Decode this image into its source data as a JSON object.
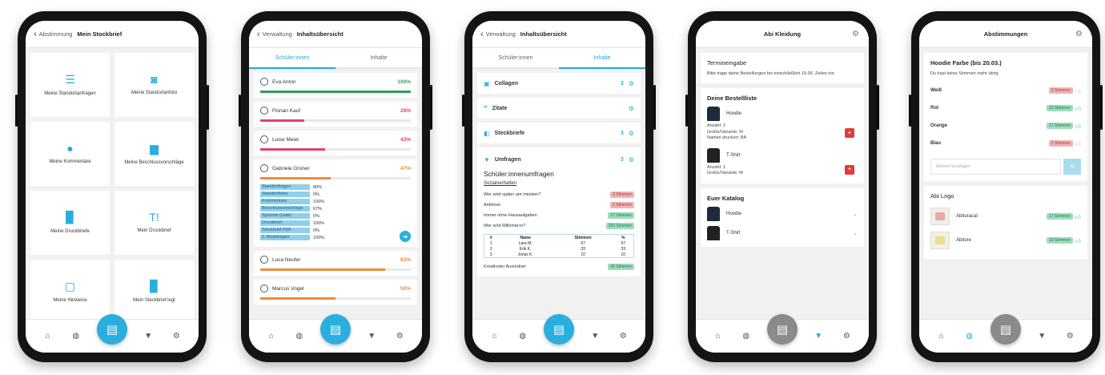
{
  "phones": [
    {
      "header": {
        "back": "Abstimmung",
        "title": "Mein Stockbrief"
      },
      "tiles": [
        {
          "icon": "☰",
          "icon_name": "list-icon",
          "label": "Meine Standortanfragen"
        },
        {
          "icon": "◙",
          "icon_name": "camera-icon",
          "label": "Meine Standortanfoto"
        },
        {
          "icon": "●",
          "icon_name": "chat-icon",
          "label": "Meine Kommentare"
        },
        {
          "icon": "▆",
          "icon_name": "suggestion-icon",
          "label": "Meine Beschlussvorschläge"
        },
        {
          "icon": "▉",
          "icon_name": "document-icon",
          "label": "Meine Druckbriefe"
        },
        {
          "icon": "T!",
          "icon_name": "text-icon",
          "label": "Mein Druckbrief"
        },
        {
          "icon": "▢",
          "icon_name": "message-icon",
          "label": "Meine Hinweise"
        },
        {
          "icon": "▉",
          "icon_name": "file-icon",
          "label": "Mein Steckbrief legt"
        }
      ]
    },
    {
      "header": {
        "back": "Verwaltung",
        "title": "Inhaltsübersicht"
      },
      "tabs": [
        "Schüler:innen",
        "Inhalte"
      ],
      "people": [
        {
          "name": "Eva Anton",
          "pct": "100%",
          "value": 100,
          "color": "#2c9e58"
        },
        {
          "name": "Florian Kauf",
          "pct": "29%",
          "value": 29,
          "color": "#e0416a"
        },
        {
          "name": "Luise Meier",
          "pct": "43%",
          "value": 43,
          "color": "#e0416a"
        },
        {
          "name": "Gabriele Grüner",
          "pct": "47%",
          "value": 47,
          "color": "#f08a3c"
        }
      ],
      "subs": [
        {
          "label": "Standortfragen",
          "value": "80%"
        },
        {
          "label": "Standortfotos",
          "value": "0%"
        },
        {
          "label": "Kommentare",
          "value": "100%"
        },
        {
          "label": "Beschlussvorschläge",
          "value": "67%"
        },
        {
          "label": "Sprüche (Liste)",
          "value": "0%"
        },
        {
          "label": "Druckbrief",
          "value": "100%"
        },
        {
          "label": "Steckbrief PDF",
          "value": "0%"
        },
        {
          "label": "2. Beantragen",
          "value": "100%"
        }
      ],
      "people2": [
        {
          "name": "Luca Neufer",
          "pct": "83%",
          "value": 83,
          "color": "#f08a3c"
        },
        {
          "name": "Marcus Vogel",
          "pct": "50%",
          "value": 50,
          "color": "#f08a3c"
        }
      ]
    },
    {
      "header": {
        "back": "Verwaltung",
        "title": "Inhaltsübersicht"
      },
      "tabs": [
        "Schüler:innen",
        "Inhalte"
      ],
      "sections": [
        {
          "icon": "▣",
          "icon_name": "collage-icon",
          "title": "Collagen",
          "count": "3"
        },
        {
          "icon": "❞",
          "icon_name": "quote-icon",
          "title": "Zitate",
          "count": ""
        },
        {
          "icon": "◧",
          "icon_name": "steckbrief-icon",
          "title": "Steckbriefe",
          "count": "3"
        },
        {
          "icon": "▼",
          "icon_name": "survey-icon",
          "title": "Umfragen",
          "count": "3"
        }
      ],
      "survey": {
        "title": "Schüler:innenumfragen",
        "subtitle": "Sozialverhalten",
        "questions": [
          {
            "q": "Wer wird später am meisten?",
            "badge": "2 Stimmen",
            "kind": "red"
          },
          {
            "q": "Antihose",
            "badge": "1 Stimmen",
            "kind": "red"
          },
          {
            "q": "Immer ohne Hausaufgaben",
            "badge": "27 Stimmen",
            "kind": "green"
          },
          {
            "q": "Wer wird Millionär:in?",
            "badge": "100 Stimmen",
            "kind": "green"
          }
        ],
        "table_head": [
          "#",
          "Name",
          "Stimmen",
          "%"
        ],
        "table_rows": [
          [
            "1",
            "Lara M.",
            "67",
            "67"
          ],
          [
            "2",
            "Erik K.",
            "33",
            "33"
          ],
          [
            "3",
            "Jonas K.",
            "10",
            "10"
          ]
        ],
        "footer_q": "Kreativster Ausredner",
        "footer_badge": "36 Stimmen"
      }
    },
    {
      "header": {
        "title": "Abi Kleidung"
      },
      "deadline": {
        "title": "Termineingabe",
        "text": "Bitte trage deine Bestellungen bis einschließlich 15.06. Zeilen ein."
      },
      "list": {
        "title": "Deine Bestellliste",
        "items": [
          {
            "name": "Hoodie",
            "details": [
              "Anzahl: 2",
              "Größe/Variante: M",
              "Namen drucken: BA"
            ]
          },
          {
            "name": "T-Shirt",
            "details": [
              "Anzahl: 1",
              "Größe/Variante: M"
            ]
          }
        ]
      },
      "catalog": {
        "title": "Euer Katalog",
        "items": [
          "Hoodie",
          "T-Shirt"
        ]
      }
    },
    {
      "header": {
        "title": "Abstimmungen"
      },
      "poll": {
        "title": "Hoodie Farbe (bis 20.03.)",
        "note": "Du hast keine Stimmen mehr übrig",
        "options": [
          {
            "name": "Weiß",
            "badge": "2 Stimmen",
            "kind": "red",
            "voted": false
          },
          {
            "name": "Rot",
            "badge": "10 Stimmen",
            "kind": "green",
            "voted": true
          },
          {
            "name": "Orange",
            "badge": "17 Stimmen",
            "kind": "green",
            "voted": true
          },
          {
            "name": "Blau",
            "badge": "2 Stimmen",
            "kind": "red",
            "voted": false
          }
        ],
        "input_placeholder": "Antwort hinzufügen"
      },
      "logo": {
        "title": "Abi Logo",
        "options": [
          {
            "name": "Abituracat",
            "badge": "17 Stimmen",
            "voted": true
          },
          {
            "name": "Abitore",
            "badge": "19 Stimmen",
            "voted": true
          }
        ]
      }
    }
  ],
  "colors": {
    "accent": "#2aaede",
    "green": "#2c9e58",
    "red": "#e0416a",
    "orange": "#f08a3c"
  },
  "nav_icons": [
    "home-icon",
    "globe-icon",
    "book-icon",
    "trophy-icon",
    "settings-icon"
  ]
}
